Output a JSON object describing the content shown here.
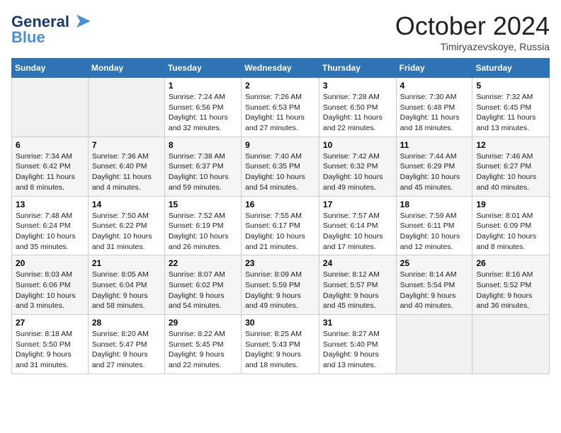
{
  "header": {
    "logo_line1": "General",
    "logo_line2": "Blue",
    "month": "October 2024",
    "location": "Timiryazevskoye, Russia"
  },
  "weekdays": [
    "Sunday",
    "Monday",
    "Tuesday",
    "Wednesday",
    "Thursday",
    "Friday",
    "Saturday"
  ],
  "weeks": [
    [
      {
        "day": "",
        "info": ""
      },
      {
        "day": "",
        "info": ""
      },
      {
        "day": "1",
        "info": "Sunrise: 7:24 AM\nSunset: 6:56 PM\nDaylight: 11 hours and 32 minutes."
      },
      {
        "day": "2",
        "info": "Sunrise: 7:26 AM\nSunset: 6:53 PM\nDaylight: 11 hours and 27 minutes."
      },
      {
        "day": "3",
        "info": "Sunrise: 7:28 AM\nSunset: 6:50 PM\nDaylight: 11 hours and 22 minutes."
      },
      {
        "day": "4",
        "info": "Sunrise: 7:30 AM\nSunset: 6:48 PM\nDaylight: 11 hours and 18 minutes."
      },
      {
        "day": "5",
        "info": "Sunrise: 7:32 AM\nSunset: 6:45 PM\nDaylight: 11 hours and 13 minutes."
      }
    ],
    [
      {
        "day": "6",
        "info": "Sunrise: 7:34 AM\nSunset: 6:42 PM\nDaylight: 11 hours and 8 minutes."
      },
      {
        "day": "7",
        "info": "Sunrise: 7:36 AM\nSunset: 6:40 PM\nDaylight: 11 hours and 4 minutes."
      },
      {
        "day": "8",
        "info": "Sunrise: 7:38 AM\nSunset: 6:37 PM\nDaylight: 10 hours and 59 minutes."
      },
      {
        "day": "9",
        "info": "Sunrise: 7:40 AM\nSunset: 6:35 PM\nDaylight: 10 hours and 54 minutes."
      },
      {
        "day": "10",
        "info": "Sunrise: 7:42 AM\nSunset: 6:32 PM\nDaylight: 10 hours and 49 minutes."
      },
      {
        "day": "11",
        "info": "Sunrise: 7:44 AM\nSunset: 6:29 PM\nDaylight: 10 hours and 45 minutes."
      },
      {
        "day": "12",
        "info": "Sunrise: 7:46 AM\nSunset: 6:27 PM\nDaylight: 10 hours and 40 minutes."
      }
    ],
    [
      {
        "day": "13",
        "info": "Sunrise: 7:48 AM\nSunset: 6:24 PM\nDaylight: 10 hours and 35 minutes."
      },
      {
        "day": "14",
        "info": "Sunrise: 7:50 AM\nSunset: 6:22 PM\nDaylight: 10 hours and 31 minutes."
      },
      {
        "day": "15",
        "info": "Sunrise: 7:52 AM\nSunset: 6:19 PM\nDaylight: 10 hours and 26 minutes."
      },
      {
        "day": "16",
        "info": "Sunrise: 7:55 AM\nSunset: 6:17 PM\nDaylight: 10 hours and 21 minutes."
      },
      {
        "day": "17",
        "info": "Sunrise: 7:57 AM\nSunset: 6:14 PM\nDaylight: 10 hours and 17 minutes."
      },
      {
        "day": "18",
        "info": "Sunrise: 7:59 AM\nSunset: 6:11 PM\nDaylight: 10 hours and 12 minutes."
      },
      {
        "day": "19",
        "info": "Sunrise: 8:01 AM\nSunset: 6:09 PM\nDaylight: 10 hours and 8 minutes."
      }
    ],
    [
      {
        "day": "20",
        "info": "Sunrise: 8:03 AM\nSunset: 6:06 PM\nDaylight: 10 hours and 3 minutes."
      },
      {
        "day": "21",
        "info": "Sunrise: 8:05 AM\nSunset: 6:04 PM\nDaylight: 9 hours and 58 minutes."
      },
      {
        "day": "22",
        "info": "Sunrise: 8:07 AM\nSunset: 6:02 PM\nDaylight: 9 hours and 54 minutes."
      },
      {
        "day": "23",
        "info": "Sunrise: 8:09 AM\nSunset: 5:59 PM\nDaylight: 9 hours and 49 minutes."
      },
      {
        "day": "24",
        "info": "Sunrise: 8:12 AM\nSunset: 5:57 PM\nDaylight: 9 hours and 45 minutes."
      },
      {
        "day": "25",
        "info": "Sunrise: 8:14 AM\nSunset: 5:54 PM\nDaylight: 9 hours and 40 minutes."
      },
      {
        "day": "26",
        "info": "Sunrise: 8:16 AM\nSunset: 5:52 PM\nDaylight: 9 hours and 36 minutes."
      }
    ],
    [
      {
        "day": "27",
        "info": "Sunrise: 8:18 AM\nSunset: 5:50 PM\nDaylight: 9 hours and 31 minutes."
      },
      {
        "day": "28",
        "info": "Sunrise: 8:20 AM\nSunset: 5:47 PM\nDaylight: 9 hours and 27 minutes."
      },
      {
        "day": "29",
        "info": "Sunrise: 8:22 AM\nSunset: 5:45 PM\nDaylight: 9 hours and 22 minutes."
      },
      {
        "day": "30",
        "info": "Sunrise: 8:25 AM\nSunset: 5:43 PM\nDaylight: 9 hours and 18 minutes."
      },
      {
        "day": "31",
        "info": "Sunrise: 8:27 AM\nSunset: 5:40 PM\nDaylight: 9 hours and 13 minutes."
      },
      {
        "day": "",
        "info": ""
      },
      {
        "day": "",
        "info": ""
      }
    ]
  ]
}
